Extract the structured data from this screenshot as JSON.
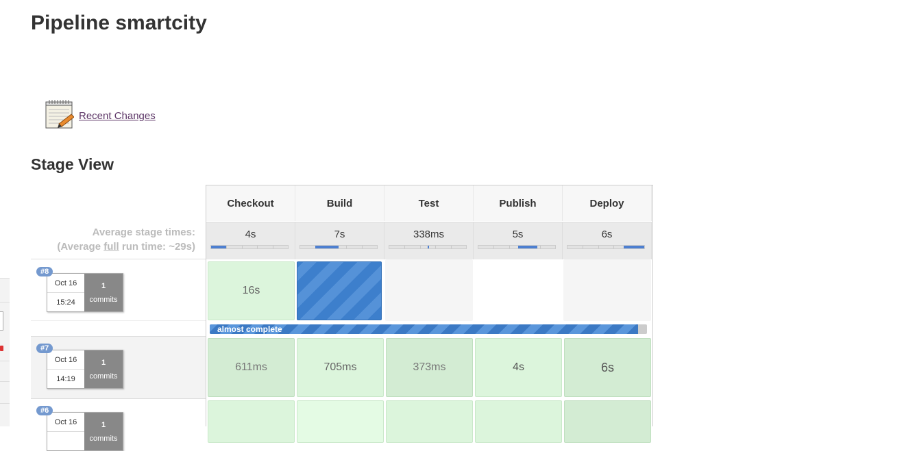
{
  "page": {
    "title": "Pipeline smartcity",
    "recent_changes_label": "Recent Changes",
    "section_title": "Stage View"
  },
  "stage_view": {
    "avg_label_line1": "Average stage times:",
    "avg_label_prefix": "(Average ",
    "avg_label_full": "full",
    "avg_label_suffix": " run time: ~29s)",
    "stages": [
      {
        "name": "Checkout",
        "avg": "4s",
        "share": 0.2
      },
      {
        "name": "Build",
        "avg": "7s",
        "share": 0.3
      },
      {
        "name": "Test",
        "avg": "338ms",
        "share": 0.02
      },
      {
        "name": "Publish",
        "avg": "5s",
        "share": 0.25
      },
      {
        "name": "Deploy",
        "avg": "6s",
        "share": 0.27
      }
    ],
    "builds": [
      {
        "number": "#8",
        "date": "Oct 16",
        "time": "15:24",
        "commits": "1",
        "commits_label": "commits",
        "cells": [
          "16s",
          "",
          "",
          "",
          ""
        ],
        "progress_label": "almost complete",
        "progress": 0.98
      },
      {
        "number": "#7",
        "date": "Oct 16",
        "time": "14:19",
        "commits": "1",
        "commits_label": "commits",
        "cells": [
          "611ms",
          "705ms",
          "373ms",
          "4s",
          "6s"
        ]
      },
      {
        "number": "#6",
        "date": "Oct 16",
        "time": "",
        "commits": "1",
        "commits_label": "commits",
        "cells": [
          "",
          "",
          "",
          "",
          ""
        ]
      }
    ]
  },
  "colors": {
    "success": "#dcf5dc",
    "running": "#3d7fcc",
    "badge": "#7499cf"
  },
  "icons": {
    "recent_changes": "notepad-icon"
  }
}
